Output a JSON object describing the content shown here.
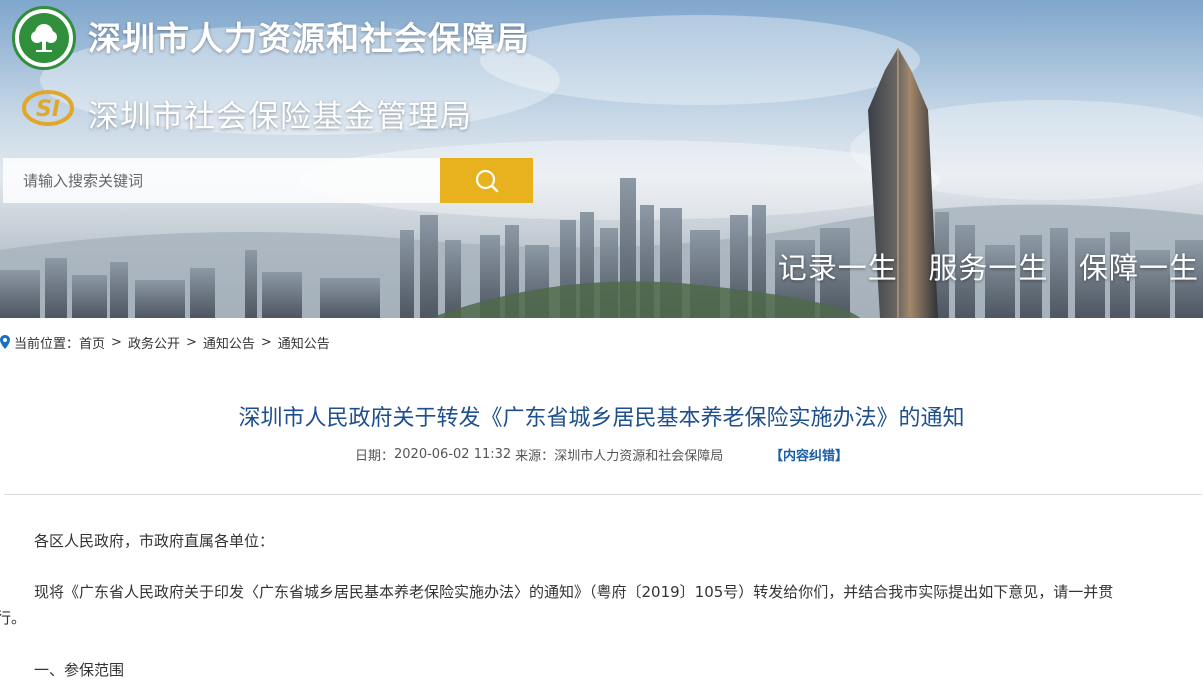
{
  "header": {
    "org_title": "深圳市人力资源和社会保障局",
    "fund_title": "深圳市社会保险基金管理局",
    "slogan": "记录一生   服务一生   保障一生",
    "logo_left": "hrss-tree-emblem-icon",
    "logo_fund": "si-fund-emblem-icon"
  },
  "search": {
    "placeholder": "请输入搜索关键词",
    "button_icon": "search-icon"
  },
  "breadcrumb": {
    "prefix": "当前位置：",
    "items": [
      "首页",
      "政务公开",
      "通知公告",
      "通知公告"
    ],
    "separator": ">"
  },
  "article": {
    "title": "深圳市人民政府关于转发《广东省城乡居民基本养老保险实施办法》的通知",
    "date_label": "日期：",
    "date": "2020-06-02 11:32",
    "source_label": "来源：",
    "source": "深圳市人力资源和社会保障局",
    "correction_link": "【内容纠错】",
    "paragraphs": [
      "各区人民政府，市政府直属各单位：",
      "现将《广东省人民政府关于印发〈广东省城乡居民基本养老保险实施办法〉的通知》（粤府〔2019〕105号）转发给你们，并结合我市实际提出如下意见，请一并贯",
      "彻执行。",
      "一、参保范围"
    ]
  },
  "colors": {
    "title_blue": "#1e4f8e",
    "link_blue": "#1a5ea8",
    "search_button": "#e8b11e",
    "logo_green": "#2f8f3a",
    "text": "#333333"
  }
}
